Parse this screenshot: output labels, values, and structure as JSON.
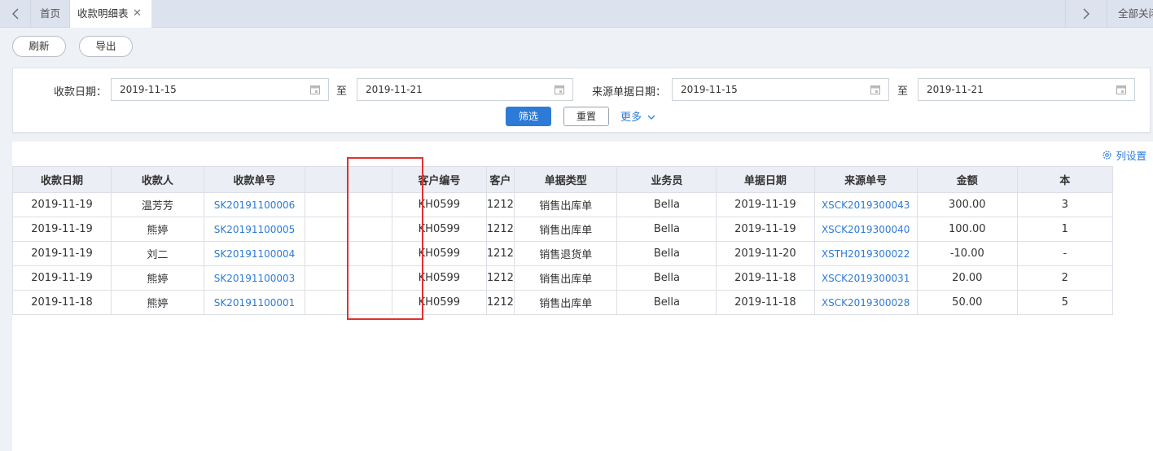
{
  "tabs": {
    "home": "首页",
    "active": "收款明细表",
    "close_all": "全部关闭"
  },
  "toolbar": {
    "refresh": "刷新",
    "export": "导出"
  },
  "filter": {
    "receipt_date_label": "收款日期：",
    "receipt_date_from": "2019-11-15",
    "to_1": "至",
    "receipt_date_to": "2019-11-21",
    "source_date_label": "来源单据日期：",
    "source_date_from": "2019-11-15",
    "to_2": "至",
    "source_date_to": "2019-11-21",
    "filter_btn": "筛选",
    "reset_btn": "重置",
    "more": "更多"
  },
  "grid": {
    "column_settings": "列设置",
    "columns": [
      "收款日期",
      "收款人",
      "收款单号",
      "",
      "客户编号",
      "",
      "客户",
      "单据类型",
      "业务员",
      "单据日期",
      "来源单号",
      "金额",
      "本"
    ],
    "rows": [
      {
        "date": "2019-11-19",
        "payee": "温芳芳",
        "no": "SK20191100006",
        "cust_code": "KH0599",
        "customer": "1212",
        "doc_type": "销售出库单",
        "sales": "Bella",
        "doc_date": "2019-11-19",
        "source_no": "XSCK2019300043",
        "amount": "300.00",
        "extra": "3"
      },
      {
        "date": "2019-11-19",
        "payee": "熊婷",
        "no": "SK20191100005",
        "cust_code": "KH0599",
        "customer": "1212",
        "doc_type": "销售出库单",
        "sales": "Bella",
        "doc_date": "2019-11-19",
        "source_no": "XSCK2019300040",
        "amount": "100.00",
        "extra": "1"
      },
      {
        "date": "2019-11-19",
        "payee": "刘二",
        "no": "SK20191100004",
        "cust_code": "KH0599",
        "customer": "1212",
        "doc_type": "销售退货单",
        "sales": "Bella",
        "doc_date": "2019-11-20",
        "source_no": "XSTH2019300022",
        "amount": "-10.00",
        "extra": "-"
      },
      {
        "date": "2019-11-19",
        "payee": "熊婷",
        "no": "SK20191100003",
        "cust_code": "KH0599",
        "customer": "1212",
        "doc_type": "销售出库单",
        "sales": "Bella",
        "doc_date": "2019-11-18",
        "source_no": "XSCK2019300031",
        "amount": "20.00",
        "extra": "2"
      },
      {
        "date": "2019-11-18",
        "payee": "熊婷",
        "no": "SK20191100001",
        "cust_code": "KH0599",
        "customer": "1212",
        "doc_type": "销售出库单",
        "sales": "Bella",
        "doc_date": "2019-11-18",
        "source_no": "XSCK2019300028",
        "amount": "50.00",
        "extra": "5"
      }
    ]
  },
  "colors": {
    "accent": "#2d7bd6",
    "highlight": "#e3302f"
  }
}
